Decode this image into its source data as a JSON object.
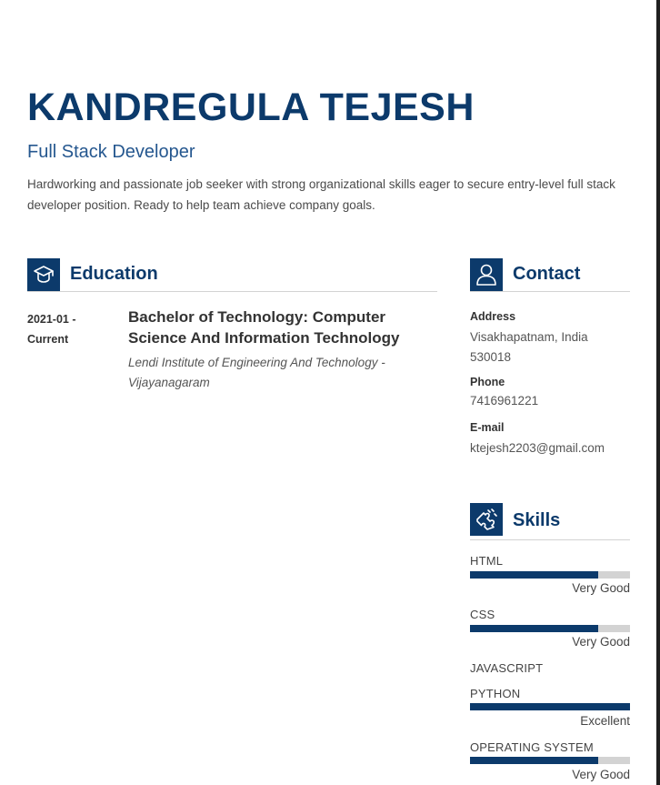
{
  "header": {
    "name": "KANDREGULA TEJESH",
    "role": "Full Stack Developer",
    "summary": "Hardworking and passionate job seeker with strong organizational skills eager to secure entry-level full stack developer position. Ready to help team achieve company goals."
  },
  "education": {
    "title": "Education",
    "icon": "graduation-cap-icon",
    "entry": {
      "date": "2021-01 - Current",
      "degree": "Bachelor of Technology: Computer Science And Information Technology",
      "school": "Lendi Institute of Engineering And Technology - Vijayanagaram"
    }
  },
  "contact": {
    "title": "Contact",
    "icon": "person-icon",
    "address_label": "Address",
    "address": "Visakhapatnam, India 530018",
    "phone_label": "Phone",
    "phone": "7416961221",
    "email_label": "E-mail",
    "email": "ktejesh2203@gmail.com"
  },
  "skills": {
    "title": "Skills",
    "icon": "puzzle-piece-icon",
    "items": [
      {
        "name": "HTML",
        "level": "Very Good",
        "fraction": 0.8
      },
      {
        "name": "CSS",
        "level": "Very Good",
        "fraction": 0.8
      },
      {
        "name": "JAVASCRIPT"
      },
      {
        "name": "PYTHON",
        "level": "Excellent",
        "fraction": 1.0
      },
      {
        "name": "OPERATING SYSTEM",
        "level": "Very Good",
        "fraction": 0.8
      }
    ]
  },
  "colors": {
    "accent": "#0c3a6b",
    "track": "#d3d3d3"
  }
}
